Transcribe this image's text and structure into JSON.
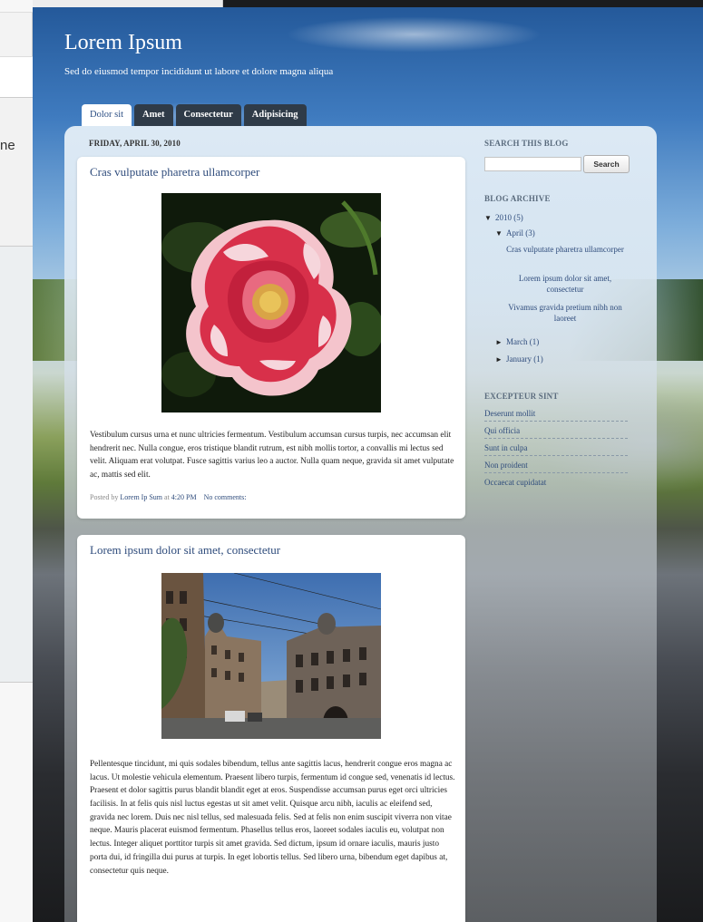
{
  "left_fragment": "ne",
  "blog": {
    "title": "Lorem Ipsum",
    "description": "Sed do eiusmod tempor incididunt ut labore et dolore magna aliqua"
  },
  "tabs": [
    {
      "label": "Dolor sit",
      "active": true
    },
    {
      "label": "Amet",
      "active": false
    },
    {
      "label": "Consectetur",
      "active": false
    },
    {
      "label": "Adipisicing",
      "active": false
    }
  ],
  "date_header": "FRIDAY, APRIL 30, 2010",
  "posts": [
    {
      "title": "Cras vulputate pharetra ullamcorper",
      "image": "rose-photo",
      "body": "Vestibulum cursus urna et nunc ultricies fermentum. Vestibulum accumsan cursus turpis, nec accumsan elit hendrerit nec. Nulla congue, eros tristique blandit rutrum, est nibh mollis tortor, a convallis mi lectus sed velit. Aliquam erat volutpat. Fusce sagittis varius leo a auctor. Nulla quam neque, gravida sit amet vulputate ac, mattis sed elit.",
      "posted_by_prefix": "Posted by",
      "author": "Lorem Ip Sum",
      "at": "at",
      "time": "4:20 PM",
      "comments": "No comments:"
    },
    {
      "title": "Lorem ipsum dolor sit amet, consectetur",
      "image": "street-photo",
      "body": "Pellentesque tincidunt, mi quis sodales bibendum, tellus ante sagittis lacus, hendrerit congue eros magna ac lacus. Ut molestie vehicula elementum. Praesent libero turpis, fermentum id congue sed, venenatis id lectus. Praesent et dolor sagittis purus blandit blandit eget at eros. Suspendisse accumsan purus eget orci ultricies facilisis. In at felis quis nisl luctus egestas ut sit amet velit. Quisque arcu nibh, iaculis ac eleifend sed, gravida nec lorem. Duis nec nisl tellus, sed malesuada felis. Sed at felis non enim suscipit viverra non vitae neque. Mauris placerat euismod fermentum. Phasellus tellus eros, laoreet sodales iaculis eu, volutpat non lectus. Integer aliquet porttitor turpis sit amet gravida. Sed dictum, ipsum id ornare iaculis, mauris justo porta dui, id fringilla dui purus at turpis. In eget lobortis tellus. Sed libero urna, bibendum eget dapibus at, consectetur quis neque."
    }
  ],
  "sidebar": {
    "search_heading": "SEARCH THIS BLOG",
    "search_button": "Search",
    "archive_heading": "BLOG ARCHIVE",
    "archive": {
      "year": "2010",
      "year_count": "(5)",
      "month_open": "April",
      "month_open_count": "(3)",
      "posts": [
        "Cras vulputate pharetra ullamcorper",
        "Lorem ipsum dolor sit amet, consectetur",
        "Vivamus gravida pretium nibh non laoreet"
      ],
      "months_closed": [
        {
          "name": "March",
          "count": "(1)"
        },
        {
          "name": "January",
          "count": "(1)"
        }
      ]
    },
    "labels_heading": "EXCEPTEUR SINT",
    "labels": [
      "Deserunt mollit",
      "Qui officia",
      "Sunt in culpa",
      "Non proident",
      "Occaecat cupidatat"
    ]
  },
  "colors": {
    "link": "#2f4c7c",
    "tab_bg": "#2f3b48",
    "sidebar_heading": "#5a6b7d"
  }
}
